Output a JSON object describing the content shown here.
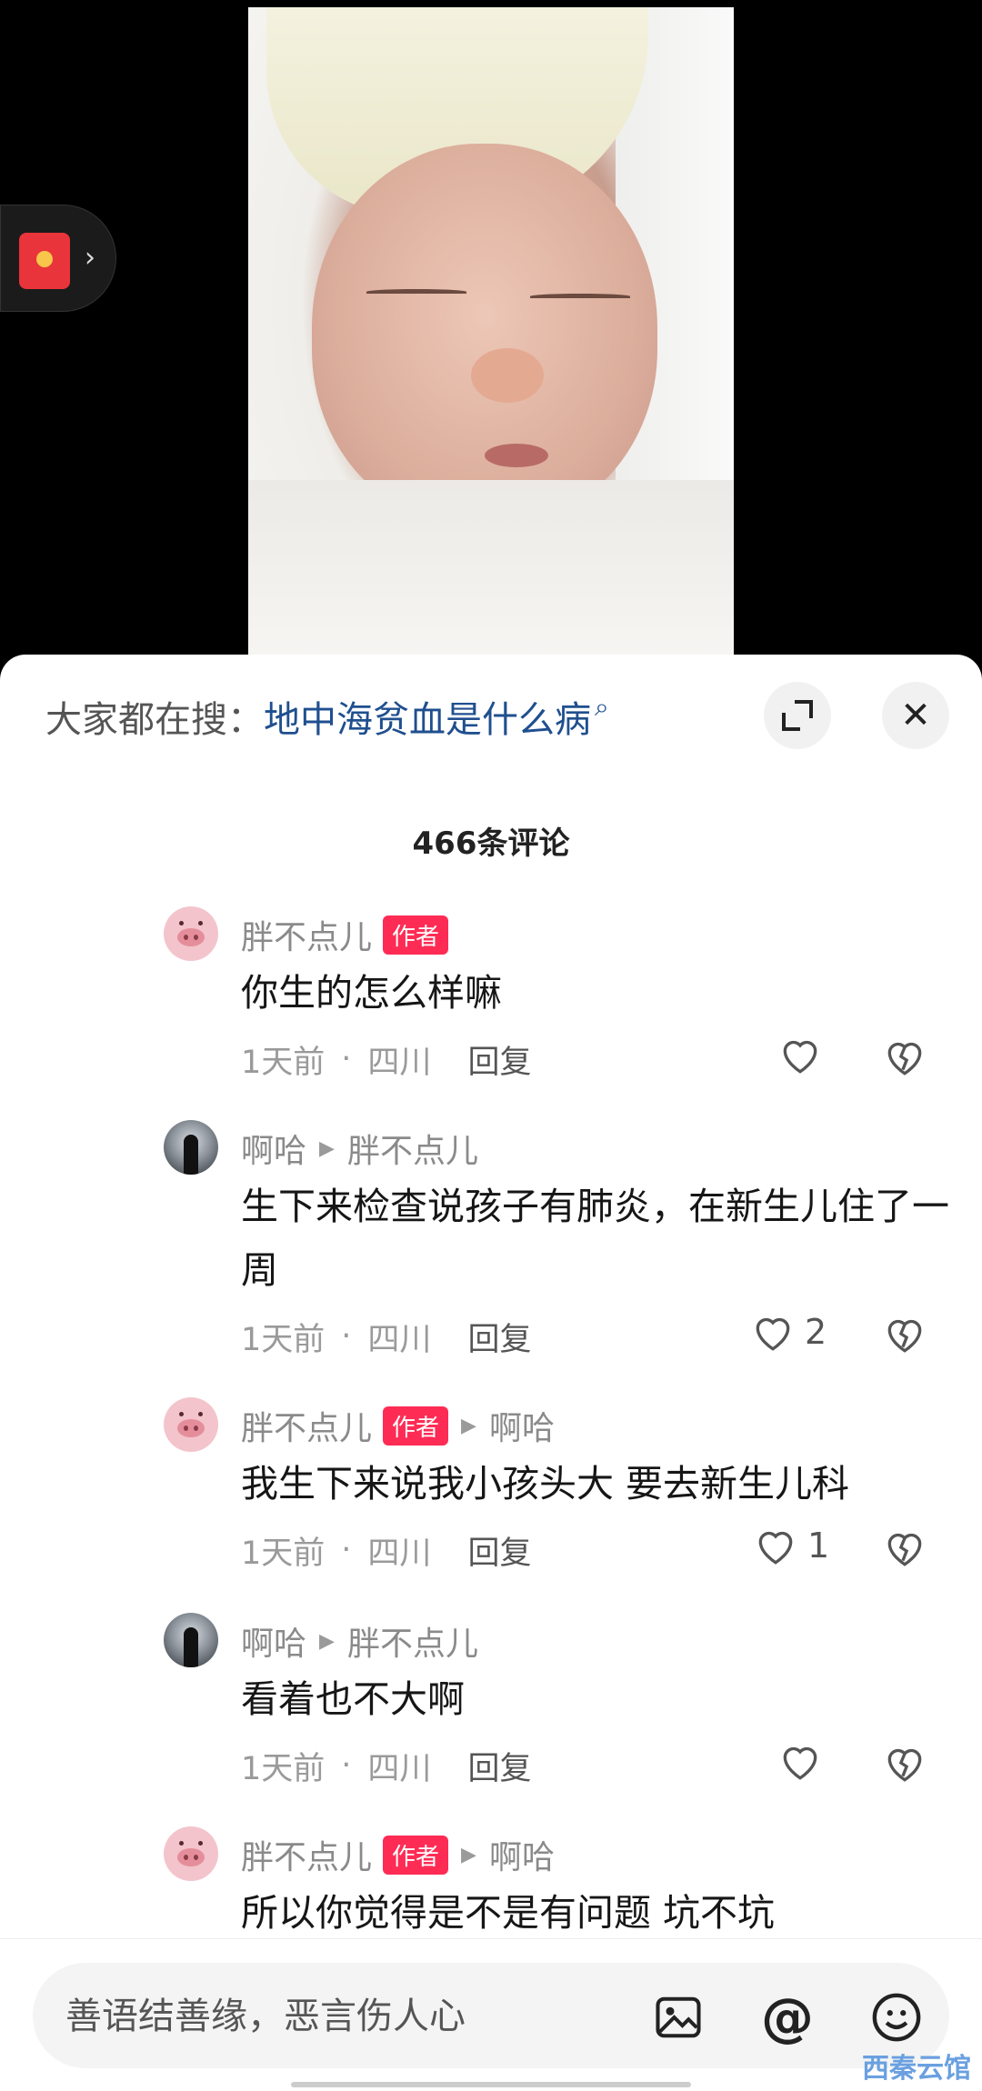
{
  "search": {
    "label": "大家都在搜：",
    "term": "地中海贫血是什么病"
  },
  "comments_header": {
    "count_text": "466条评论"
  },
  "author_badge": "作者",
  "comments": [
    {
      "user": "胖不点儿",
      "is_author": true,
      "reply_to": "",
      "text": "你生的怎么样嘛",
      "time": "1天前",
      "location": "四川",
      "reply_label": "回复",
      "likes": ""
    },
    {
      "user": "啊哈",
      "is_author": false,
      "reply_to": "胖不点儿",
      "text": "生下来检查说孩子有肺炎，在新生儿住了一周",
      "time": "1天前",
      "location": "四川",
      "reply_label": "回复",
      "likes": "2"
    },
    {
      "user": "胖不点儿",
      "is_author": true,
      "reply_to": "啊哈",
      "text": "我生下来说我小孩头大  要去新生儿科",
      "time": "1天前",
      "location": "四川",
      "reply_label": "回复",
      "likes": "1"
    },
    {
      "user": "啊哈",
      "is_author": false,
      "reply_to": "胖不点儿",
      "text": "看着也不大啊",
      "time": "1天前",
      "location": "四川",
      "reply_label": "回复",
      "likes": ""
    },
    {
      "user": "胖不点儿",
      "is_author": true,
      "reply_to": "啊哈",
      "text": "所以你觉得是不是有问题 坑不坑",
      "time": "",
      "location": "",
      "reply_label": "",
      "likes": ""
    }
  ],
  "input": {
    "placeholder": "善语结善缘，恶言伤人心"
  },
  "icons": {
    "image": "image-icon",
    "mention": "at-icon",
    "emoji": "emoji-icon",
    "expand": "expand-icon",
    "close": "close-icon"
  },
  "watermark": "西秦云馆",
  "colors": {
    "author_badge": "#fe2c55",
    "search_term": "#1f4f8f",
    "red_packet": "#e8343a"
  }
}
